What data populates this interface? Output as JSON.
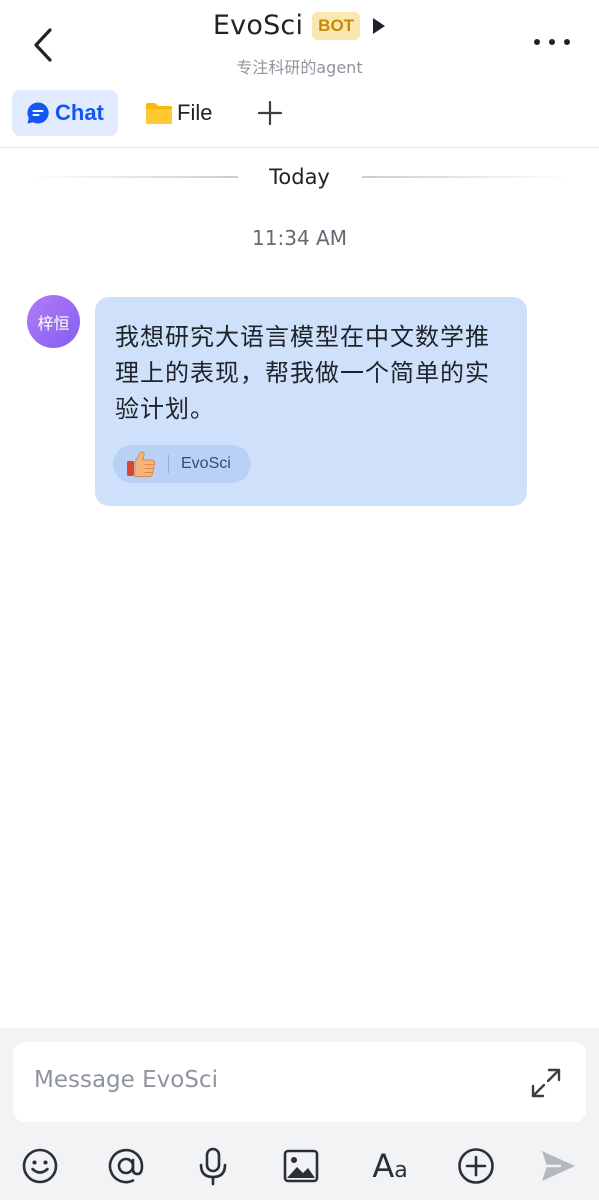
{
  "header": {
    "title": "EvoSci",
    "badge": "BOT",
    "subtitle": "专注科研的agent"
  },
  "tabs": [
    {
      "label": "Chat",
      "icon": "chat-bubble-icon",
      "active": true
    },
    {
      "label": "File",
      "icon": "folder-icon",
      "active": false
    }
  ],
  "conversation": {
    "date_divider": "Today",
    "timestamp": "11:34 AM",
    "messages": [
      {
        "avatar_text": "梓恒",
        "text": "我想研究大语言模型在中文数学推理上的表现，帮我做一个简单的实验计划。",
        "reaction": {
          "emoji": "thumbs-up-icon",
          "user": "EvoSci"
        }
      }
    ]
  },
  "composer": {
    "placeholder": "Message EvoSci",
    "tools": [
      "emoji-icon",
      "mention-icon",
      "microphone-icon",
      "image-icon",
      "text-format-icon",
      "add-circle-icon",
      "send-icon"
    ]
  },
  "colors": {
    "accent": "#1456f0",
    "bubble": "#cfe0fb",
    "badge_bg": "#fbe7b2",
    "badge_text": "#c68a03"
  }
}
